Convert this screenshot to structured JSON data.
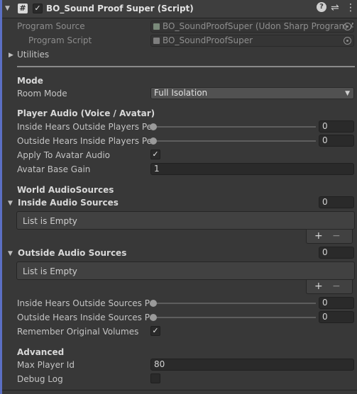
{
  "component": {
    "title": "BO_Sound Proof Super (Script)",
    "enabled": true,
    "script_icon": "#",
    "header_icons": [
      "help-icon",
      "preset-icon",
      "more-icon"
    ],
    "help_glyph": "?",
    "preset_glyph": "⇌",
    "more_glyph": "⋮"
  },
  "program_source": {
    "label": "Program Source",
    "value": "BO_SoundProofSuper (Udon Sharp Program Asset)"
  },
  "program_script": {
    "label": "Program Script",
    "value": "BO_SoundProofSuper"
  },
  "utilities": {
    "label": "Utilities"
  },
  "mode": {
    "heading": "Mode",
    "room_mode_label": "Room Mode",
    "room_mode_value": "Full Isolation"
  },
  "player_audio": {
    "heading": "Player Audio (Voice / Avatar)",
    "inside_hears_outside_label": "Inside Hears Outside Players Percent",
    "inside_hears_outside_value": "0",
    "outside_hears_inside_label": "Outside Hears Inside Players Percent",
    "outside_hears_inside_value": "0",
    "apply_avatar_label": "Apply To Avatar Audio",
    "apply_avatar_checked": true,
    "avatar_base_gain_label": "Avatar Base Gain",
    "avatar_base_gain_value": "1"
  },
  "world_audio": {
    "heading": "World AudioSources",
    "inside_sources_label": "Inside Audio Sources",
    "inside_sources_count": "0",
    "inside_list_empty": "List is Empty",
    "outside_sources_label": "Outside Audio Sources",
    "outside_sources_count": "0",
    "outside_list_empty": "List is Empty",
    "inside_hears_outside_sources_label": "Inside Hears Outside Sources Percent",
    "inside_hears_outside_sources_value": "0",
    "outside_hears_inside_sources_label": "Outside Hears Inside Sources Percent",
    "outside_hears_inside_sources_value": "0",
    "remember_volumes_label": "Remember Original Volumes",
    "remember_volumes_checked": true
  },
  "advanced": {
    "heading": "Advanced",
    "max_player_id_label": "Max Player Id",
    "max_player_id_value": "80",
    "debug_log_label": "Debug Log",
    "debug_log_checked": false
  },
  "list_controls": {
    "add": "+",
    "remove": "−"
  },
  "check_glyph": "✓",
  "colors": {
    "accent": "#5b6fc4",
    "background": "#383838",
    "field": "#2a2a2a"
  }
}
